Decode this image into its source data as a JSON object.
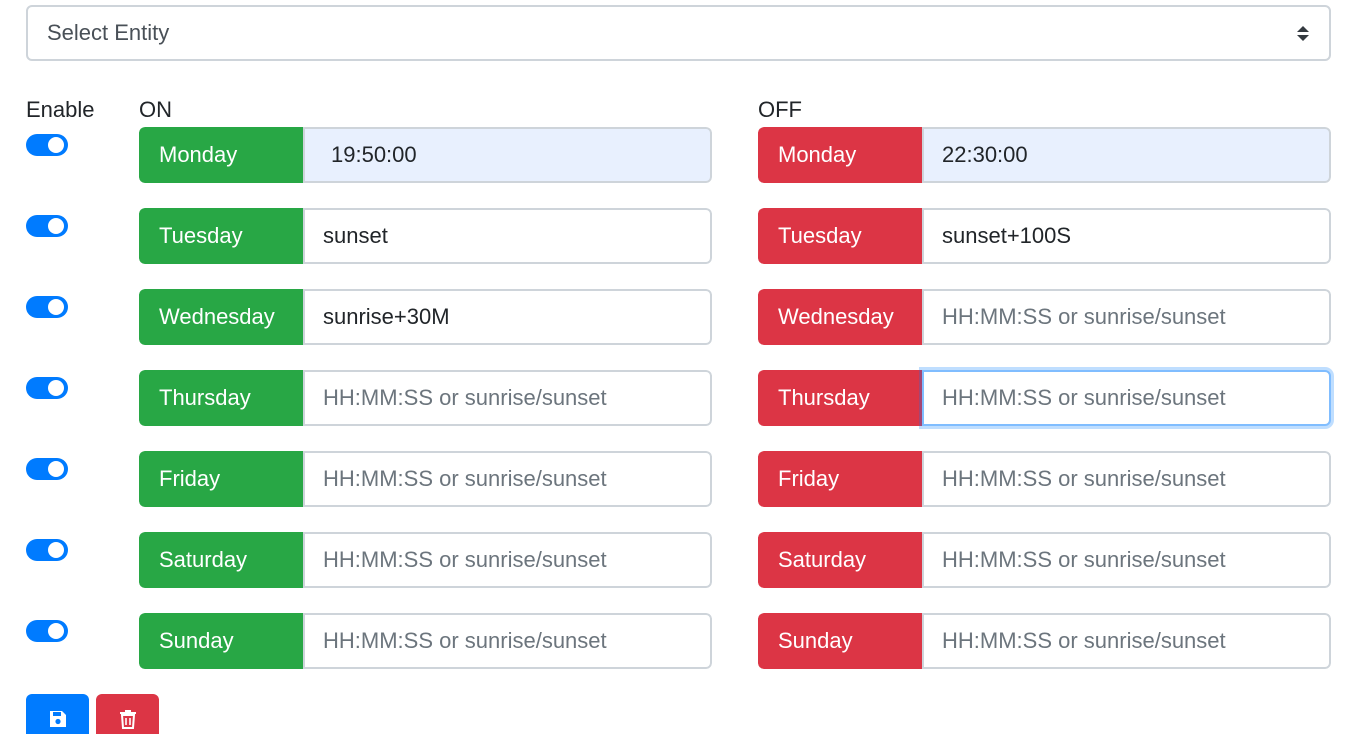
{
  "select": {
    "label": "Select Entity",
    "icon": "sort-caret-icon"
  },
  "labels": {
    "enable": "Enable",
    "on": "ON",
    "off": "OFF"
  },
  "colors": {
    "primary": "#007bff",
    "on_green": "#28a745",
    "off_red": "#dc3545"
  },
  "days": [
    {
      "name": "Monday",
      "enabled": true,
      "on_value": "19:50:00",
      "off_value": "22:30:00"
    },
    {
      "name": "Tuesday",
      "enabled": true,
      "on_value": "sunset",
      "off_value": "sunset+100S"
    },
    {
      "name": "Wednesday",
      "enabled": true,
      "on_value": "sunrise+30M",
      "off_value": ""
    },
    {
      "name": "Thursday",
      "enabled": true,
      "on_value": "",
      "off_value": ""
    },
    {
      "name": "Friday",
      "enabled": true,
      "on_value": "",
      "off_value": ""
    },
    {
      "name": "Saturday",
      "enabled": true,
      "on_value": "",
      "off_value": ""
    },
    {
      "name": "Sunday",
      "enabled": true,
      "on_value": "",
      "off_value": ""
    }
  ],
  "placeholder": "HH:MM:SS or sunrise/sunset",
  "buttons": {
    "save_icon": "floppy-disk-icon",
    "delete_icon": "trash-icon"
  }
}
